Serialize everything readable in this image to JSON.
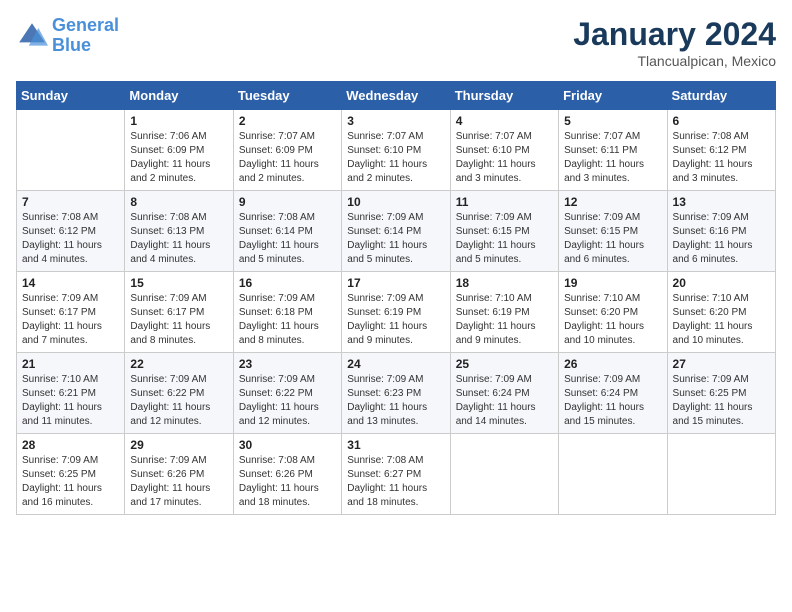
{
  "header": {
    "logo_line1": "General",
    "logo_line2": "Blue",
    "month": "January 2024",
    "location": "Tlancualpican, Mexico"
  },
  "days_of_week": [
    "Sunday",
    "Monday",
    "Tuesday",
    "Wednesday",
    "Thursday",
    "Friday",
    "Saturday"
  ],
  "weeks": [
    [
      {
        "day": "",
        "info": ""
      },
      {
        "day": "1",
        "info": "Sunrise: 7:06 AM\nSunset: 6:09 PM\nDaylight: 11 hours\nand 2 minutes."
      },
      {
        "day": "2",
        "info": "Sunrise: 7:07 AM\nSunset: 6:09 PM\nDaylight: 11 hours\nand 2 minutes."
      },
      {
        "day": "3",
        "info": "Sunrise: 7:07 AM\nSunset: 6:10 PM\nDaylight: 11 hours\nand 2 minutes."
      },
      {
        "day": "4",
        "info": "Sunrise: 7:07 AM\nSunset: 6:10 PM\nDaylight: 11 hours\nand 3 minutes."
      },
      {
        "day": "5",
        "info": "Sunrise: 7:07 AM\nSunset: 6:11 PM\nDaylight: 11 hours\nand 3 minutes."
      },
      {
        "day": "6",
        "info": "Sunrise: 7:08 AM\nSunset: 6:12 PM\nDaylight: 11 hours\nand 3 minutes."
      }
    ],
    [
      {
        "day": "7",
        "info": "Sunrise: 7:08 AM\nSunset: 6:12 PM\nDaylight: 11 hours\nand 4 minutes."
      },
      {
        "day": "8",
        "info": "Sunrise: 7:08 AM\nSunset: 6:13 PM\nDaylight: 11 hours\nand 4 minutes."
      },
      {
        "day": "9",
        "info": "Sunrise: 7:08 AM\nSunset: 6:14 PM\nDaylight: 11 hours\nand 5 minutes."
      },
      {
        "day": "10",
        "info": "Sunrise: 7:09 AM\nSunset: 6:14 PM\nDaylight: 11 hours\nand 5 minutes."
      },
      {
        "day": "11",
        "info": "Sunrise: 7:09 AM\nSunset: 6:15 PM\nDaylight: 11 hours\nand 5 minutes."
      },
      {
        "day": "12",
        "info": "Sunrise: 7:09 AM\nSunset: 6:15 PM\nDaylight: 11 hours\nand 6 minutes."
      },
      {
        "day": "13",
        "info": "Sunrise: 7:09 AM\nSunset: 6:16 PM\nDaylight: 11 hours\nand 6 minutes."
      }
    ],
    [
      {
        "day": "14",
        "info": "Sunrise: 7:09 AM\nSunset: 6:17 PM\nDaylight: 11 hours\nand 7 minutes."
      },
      {
        "day": "15",
        "info": "Sunrise: 7:09 AM\nSunset: 6:17 PM\nDaylight: 11 hours\nand 8 minutes."
      },
      {
        "day": "16",
        "info": "Sunrise: 7:09 AM\nSunset: 6:18 PM\nDaylight: 11 hours\nand 8 minutes."
      },
      {
        "day": "17",
        "info": "Sunrise: 7:09 AM\nSunset: 6:19 PM\nDaylight: 11 hours\nand 9 minutes."
      },
      {
        "day": "18",
        "info": "Sunrise: 7:10 AM\nSunset: 6:19 PM\nDaylight: 11 hours\nand 9 minutes."
      },
      {
        "day": "19",
        "info": "Sunrise: 7:10 AM\nSunset: 6:20 PM\nDaylight: 11 hours\nand 10 minutes."
      },
      {
        "day": "20",
        "info": "Sunrise: 7:10 AM\nSunset: 6:20 PM\nDaylight: 11 hours\nand 10 minutes."
      }
    ],
    [
      {
        "day": "21",
        "info": "Sunrise: 7:10 AM\nSunset: 6:21 PM\nDaylight: 11 hours\nand 11 minutes."
      },
      {
        "day": "22",
        "info": "Sunrise: 7:09 AM\nSunset: 6:22 PM\nDaylight: 11 hours\nand 12 minutes."
      },
      {
        "day": "23",
        "info": "Sunrise: 7:09 AM\nSunset: 6:22 PM\nDaylight: 11 hours\nand 12 minutes."
      },
      {
        "day": "24",
        "info": "Sunrise: 7:09 AM\nSunset: 6:23 PM\nDaylight: 11 hours\nand 13 minutes."
      },
      {
        "day": "25",
        "info": "Sunrise: 7:09 AM\nSunset: 6:24 PM\nDaylight: 11 hours\nand 14 minutes."
      },
      {
        "day": "26",
        "info": "Sunrise: 7:09 AM\nSunset: 6:24 PM\nDaylight: 11 hours\nand 15 minutes."
      },
      {
        "day": "27",
        "info": "Sunrise: 7:09 AM\nSunset: 6:25 PM\nDaylight: 11 hours\nand 15 minutes."
      }
    ],
    [
      {
        "day": "28",
        "info": "Sunrise: 7:09 AM\nSunset: 6:25 PM\nDaylight: 11 hours\nand 16 minutes."
      },
      {
        "day": "29",
        "info": "Sunrise: 7:09 AM\nSunset: 6:26 PM\nDaylight: 11 hours\nand 17 minutes."
      },
      {
        "day": "30",
        "info": "Sunrise: 7:08 AM\nSunset: 6:26 PM\nDaylight: 11 hours\nand 18 minutes."
      },
      {
        "day": "31",
        "info": "Sunrise: 7:08 AM\nSunset: 6:27 PM\nDaylight: 11 hours\nand 18 minutes."
      },
      {
        "day": "",
        "info": ""
      },
      {
        "day": "",
        "info": ""
      },
      {
        "day": "",
        "info": ""
      }
    ]
  ]
}
